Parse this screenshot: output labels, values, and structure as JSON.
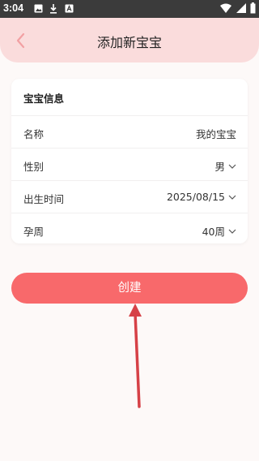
{
  "status_bar": {
    "time": "3:04",
    "left_icons": [
      "image-icon",
      "download-icon",
      "a-icon"
    ],
    "right_icons": [
      "wifi-icon",
      "signal-icon",
      "battery-icon"
    ]
  },
  "header": {
    "title": "添加新宝宝",
    "back_icon": "chevron-left-icon",
    "background": "#fadcdc",
    "accent": "#f2a0a3"
  },
  "baby_info": {
    "title": "宝宝信息",
    "fields": [
      {
        "label": "名称",
        "value": "我的宝宝",
        "dropdown": false
      },
      {
        "label": "性别",
        "value": "男",
        "dropdown": true
      },
      {
        "label": "出生时间",
        "value": "2025/08/15",
        "dropdown": true
      },
      {
        "label": "孕周",
        "value": "40周",
        "dropdown": true
      }
    ]
  },
  "actions": {
    "create_label": "创建",
    "create_color": "#f8696b"
  }
}
